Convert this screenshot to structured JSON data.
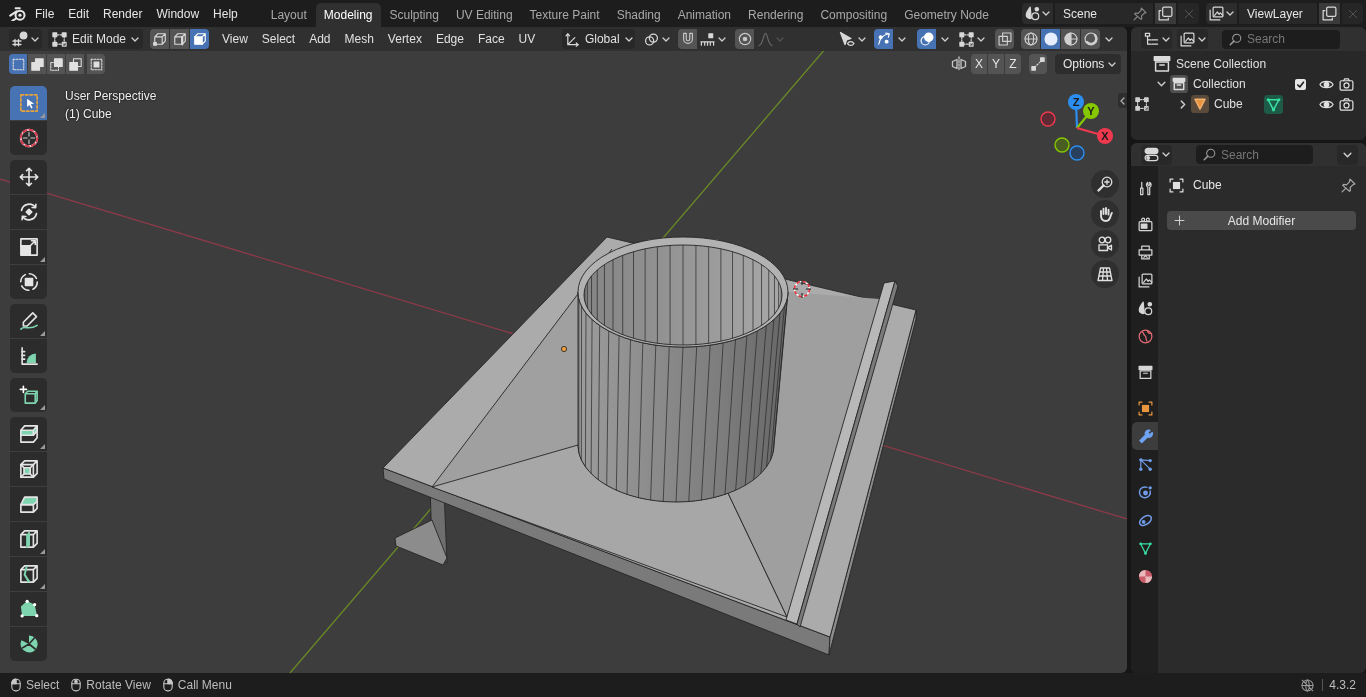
{
  "top_bar": {
    "menus": [
      "File",
      "Edit",
      "Render",
      "Window",
      "Help"
    ],
    "workspace_tabs": [
      {
        "label": "Layout",
        "selected": false
      },
      {
        "label": "Modeling",
        "selected": true
      },
      {
        "label": "Sculpting",
        "selected": false
      },
      {
        "label": "UV Editing",
        "selected": false
      },
      {
        "label": "Texture Paint",
        "selected": false
      },
      {
        "label": "Shading",
        "selected": false
      },
      {
        "label": "Animation",
        "selected": false
      },
      {
        "label": "Rendering",
        "selected": false
      },
      {
        "label": "Compositing",
        "selected": false
      },
      {
        "label": "Geometry Node",
        "selected": false
      }
    ],
    "scene": "Scene",
    "view_layer": "ViewLayer"
  },
  "viewport_header": {
    "mode": "Edit Mode",
    "select_modes": [
      {
        "kind": "vertex",
        "selected": false
      },
      {
        "kind": "edge",
        "selected": false
      },
      {
        "kind": "face",
        "selected": true
      }
    ],
    "menus": [
      "View",
      "Select",
      "Add",
      "Mesh",
      "Vertex",
      "Edge",
      "Face",
      "UV"
    ],
    "orientation": "Global",
    "snap": {
      "on": false
    },
    "proportional_editing": {
      "on": false
    },
    "gizmos": {
      "on": true
    },
    "overlays": {
      "on": true
    },
    "xray": {
      "on": false
    },
    "shading_modes": [
      {
        "kind": "wireframe",
        "selected": false
      },
      {
        "kind": "solid",
        "selected": true
      },
      {
        "kind": "material",
        "selected": false
      },
      {
        "kind": "rendered",
        "selected": false
      }
    ]
  },
  "tool_settings": {
    "select_ops": [
      {
        "kind": "set",
        "selected": true
      },
      {
        "kind": "extend",
        "selected": false
      },
      {
        "kind": "subtract",
        "selected": false
      },
      {
        "kind": "invert",
        "selected": false
      },
      {
        "kind": "intersect",
        "selected": false
      }
    ],
    "mirror_axes": [
      {
        "label": "X",
        "on": false
      },
      {
        "label": "Y",
        "on": false
      },
      {
        "label": "Z",
        "on": false
      }
    ],
    "options": "Options"
  },
  "toolbar": {
    "groups": [
      {
        "tools": [
          {
            "kind": "select_box",
            "selected": true,
            "flyout": true
          },
          {
            "kind": "cursor",
            "selected": false,
            "flyout": false
          }
        ]
      },
      {
        "tools": [
          {
            "kind": "move",
            "selected": false,
            "flyout": false
          },
          {
            "kind": "rotate",
            "selected": false,
            "flyout": false
          },
          {
            "kind": "scale",
            "selected": false,
            "flyout": true
          },
          {
            "kind": "transform",
            "selected": false,
            "flyout": false
          }
        ]
      },
      {
        "tools": [
          {
            "kind": "annotate",
            "selected": false,
            "flyout": true
          },
          {
            "kind": "measure",
            "selected": false,
            "flyout": false
          }
        ]
      },
      {
        "tools": [
          {
            "kind": "add_cube",
            "selected": false,
            "flyout": true
          }
        ]
      },
      {
        "tools": [
          {
            "kind": "extrude",
            "selected": false,
            "flyout": true
          },
          {
            "kind": "inset",
            "selected": false,
            "flyout": false
          },
          {
            "kind": "bevel",
            "selected": false,
            "flyout": false
          },
          {
            "kind": "loop_cut",
            "selected": false,
            "flyout": true
          },
          {
            "kind": "knife",
            "selected": false,
            "flyout": true
          },
          {
            "kind": "poly_build",
            "selected": false,
            "flyout": false
          },
          {
            "kind": "spin",
            "selected": false,
            "flyout": false
          }
        ]
      }
    ]
  },
  "viewport": {
    "view_name": "User Perspective",
    "object_info": "(1) Cube",
    "gizmo_axes": [
      {
        "kind": "z",
        "label": "Z"
      },
      {
        "kind": "y",
        "label": "Y"
      },
      {
        "kind": "x",
        "label": "X"
      }
    ]
  },
  "outliner": {
    "search_placeholder": "Search",
    "tree": [
      {
        "label": "Scene Collection",
        "kind": "scene_collection",
        "children": [
          {
            "label": "Collection",
            "kind": "collection",
            "expanded": true,
            "checked": true,
            "visible": true,
            "renderable": true,
            "children": [
              {
                "label": "Cube",
                "kind": "mesh_object",
                "expanded": false,
                "edit_mode": true,
                "visible": true,
                "renderable": true
              }
            ]
          }
        ]
      }
    ]
  },
  "properties": {
    "search_placeholder": "Search",
    "tab_groups": [
      {
        "tabs": [
          {
            "kind": "tool",
            "selected": false
          }
        ]
      },
      {
        "tabs": [
          {
            "kind": "render",
            "selected": false
          },
          {
            "kind": "output",
            "selected": false
          },
          {
            "kind": "view_layer",
            "selected": false
          },
          {
            "kind": "scene",
            "selected": false
          },
          {
            "kind": "world",
            "selected": false
          }
        ]
      },
      {
        "tabs": [
          {
            "kind": "collection",
            "selected": false
          }
        ]
      },
      {
        "tabs": [
          {
            "kind": "object",
            "selected": false
          },
          {
            "kind": "modifiers",
            "selected": true
          },
          {
            "kind": "particles",
            "selected": false
          },
          {
            "kind": "physics",
            "selected": false
          },
          {
            "kind": "constraints",
            "selected": false
          },
          {
            "kind": "data",
            "selected": false
          },
          {
            "kind": "material",
            "selected": false
          }
        ]
      }
    ],
    "object_name": "Cube",
    "add_modifier": "Add Modifier"
  },
  "status_bar": {
    "hints": [
      {
        "kind": "left_click",
        "label": "Select"
      },
      {
        "kind": "middle_click",
        "label": "Rotate View"
      },
      {
        "kind": "right_click",
        "label": "Call Menu"
      }
    ],
    "version": "4.3.2"
  }
}
